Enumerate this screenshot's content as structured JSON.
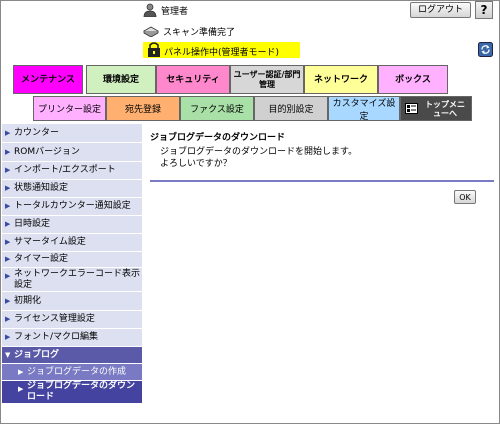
{
  "header": {
    "admin_label": "管理者",
    "logout_label": "ログアウト",
    "help_label": "?",
    "scan_status": "スキャン準備完了",
    "panel_status": "パネル操作中(管理者モード)"
  },
  "main_tabs": [
    {
      "label": "メンテナンス",
      "color": "#ff00ff",
      "active": true
    },
    {
      "label": "環境設定",
      "color": "#d0f0c0"
    },
    {
      "label": "セキュリティ",
      "color": "#ff88cc"
    },
    {
      "label": "ユーザー認証/部門管理",
      "color": "#d7d7d7"
    },
    {
      "label": "ネットワーク",
      "color": "#ffff99"
    },
    {
      "label": "ボックス",
      "color": "#ffb0ff"
    }
  ],
  "sub_tabs": [
    {
      "label": "プリンター設定",
      "color": "#ffb0ff"
    },
    {
      "label": "宛先登録",
      "color": "#ffb070"
    },
    {
      "label": "ファクス設定",
      "color": "#a8e0a8"
    },
    {
      "label": "目的別設定",
      "color": "#d0d0d0"
    },
    {
      "label": "カスタマイズ設定",
      "color": "#a8d8ff"
    },
    {
      "label": "トップメニューへ",
      "color": "#4a4a4a"
    }
  ],
  "sidebar": {
    "items": [
      {
        "label": "カウンター"
      },
      {
        "label": "ROMバージョン"
      },
      {
        "label": "インポート/エクスポート"
      },
      {
        "label": "状態通知設定"
      },
      {
        "label": "トータルカウンター通知設定"
      },
      {
        "label": "日時設定"
      },
      {
        "label": "サマータイム設定"
      },
      {
        "label": "タイマー設定"
      },
      {
        "label": "ネットワークエラーコード表示設定"
      },
      {
        "label": "初期化"
      },
      {
        "label": "ライセンス管理設定"
      },
      {
        "label": "フォント/マクロ編集"
      },
      {
        "label": "ジョブログ"
      }
    ],
    "subitems": [
      {
        "label": "ジョブログデータの作成"
      },
      {
        "label": "ジョブログデータのダウンロード"
      }
    ]
  },
  "content": {
    "title": "ジョブログデータのダウンロード",
    "line1": "ジョブログデータのダウンロードを開始します。",
    "line2": "よろしいですか？",
    "ok_label": "OK"
  }
}
